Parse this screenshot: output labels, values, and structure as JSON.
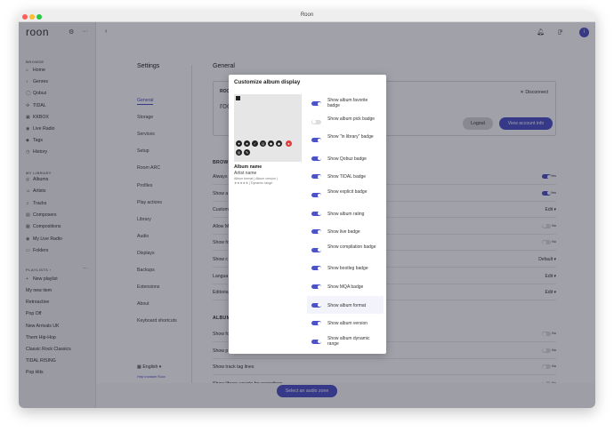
{
  "window": {
    "title": "Roon"
  },
  "sidebar": {
    "logo": "roon",
    "browse_header": "BROWSE",
    "browse": [
      {
        "icon": "home-icon",
        "glyph": "⌂",
        "label": "Home"
      },
      {
        "icon": "genres-icon",
        "glyph": "♪",
        "label": "Genres"
      },
      {
        "icon": "qobuz-icon",
        "glyph": "◯",
        "label": "Qobuz"
      },
      {
        "icon": "tidal-icon",
        "glyph": "✣",
        "label": "TIDAL"
      },
      {
        "icon": "kkbox-icon",
        "glyph": "▣",
        "label": "KKBOX"
      },
      {
        "icon": "radio-icon",
        "glyph": "◉",
        "label": "Live Radio"
      },
      {
        "icon": "tag-icon",
        "glyph": "◆",
        "label": "Tags"
      },
      {
        "icon": "history-icon",
        "glyph": "◷",
        "label": "History"
      }
    ],
    "library_header": "MY LIBRARY",
    "library": [
      {
        "icon": "albums-icon",
        "glyph": "◎",
        "label": "Albums"
      },
      {
        "icon": "artists-icon",
        "glyph": "☺",
        "label": "Artists"
      },
      {
        "icon": "tracks-icon",
        "glyph": "♫",
        "label": "Tracks"
      },
      {
        "icon": "composers-icon",
        "glyph": "▤",
        "label": "Composers"
      },
      {
        "icon": "compositions-icon",
        "glyph": "▦",
        "label": "Compositions"
      },
      {
        "icon": "radio-icon",
        "glyph": "◉",
        "label": "My Live Radio"
      },
      {
        "icon": "folder-icon",
        "glyph": "▭",
        "label": "Folders"
      }
    ],
    "playlists_header": "PLAYLISTS ›",
    "playlists_more": "···",
    "new_playlist": "New playlist",
    "playlists": [
      "My new item",
      "Retroactive",
      "Pop Off",
      "New Arrivals UK",
      "Them Hip-Hop",
      "Classic Rock Classics",
      "TIDAL RISING",
      "Pop Hits"
    ]
  },
  "settings_nav": {
    "title": "Settings",
    "items": [
      "General",
      "Storage",
      "Services",
      "Setup",
      "Room ARC",
      "Profiles",
      "Play actions",
      "Library",
      "Audio",
      "Displays",
      "Backups",
      "Extensions",
      "About",
      "Keyboard shortcuts"
    ],
    "active": "General",
    "language": "English",
    "help_link": "Help translate Roon"
  },
  "content": {
    "title": "General",
    "account_label": "ROON",
    "account_logo": "roon",
    "disconnect": "✕ Disconnect",
    "logout": "Logout",
    "view_account": "View account info",
    "browse_section": "BROWSE",
    "rows": [
      {
        "label": "Always",
        "value": "Yes",
        "toggle": "on"
      },
      {
        "label": "Show a",
        "value": "Yes",
        "toggle": "on"
      },
      {
        "label": "Custom",
        "value": "Edit ▾",
        "toggle": ""
      },
      {
        "label": "Allow M",
        "value": "No",
        "toggle": "off"
      },
      {
        "label": "Show fo",
        "value": "No",
        "toggle": "off"
      },
      {
        "label": "Show c",
        "value": "Default ▾",
        "toggle": ""
      },
      {
        "label": "Langua",
        "value": "Edit ▾",
        "toggle": ""
      },
      {
        "label": "Editoria",
        "value": "Edit ▾",
        "toggle": ""
      }
    ],
    "album_section": "ALBUM",
    "rows2": [
      {
        "label": "Show fo",
        "value": "No",
        "toggle": "off"
      },
      {
        "label": "Show p",
        "value": "No",
        "toggle": "off"
      },
      {
        "label": "Show track tag lines",
        "value": "No",
        "toggle": "off"
      },
      {
        "label": "Show library counts for recordings",
        "value": "No",
        "toggle": "off"
      }
    ]
  },
  "zone_button": "Select an audio zone",
  "modal": {
    "title": "Customize album display",
    "album_name": "Album name",
    "artist_name": "Artist name",
    "meta1": "Album format | Album version |",
    "meta2": "★★★★★ | Dynamic range",
    "options": [
      {
        "label": "Show album favorite badge",
        "on": true
      },
      {
        "label": "Show album pick badge",
        "on": false
      },
      {
        "label": "Show \"in library\" badge",
        "on": true
      },
      {
        "label": "Show Qobuz badge",
        "on": true
      },
      {
        "label": "Show TIDAL badge",
        "on": true
      },
      {
        "label": "Show explicit badge",
        "on": true
      },
      {
        "label": "Show album rating",
        "on": true
      },
      {
        "label": "Show live badge",
        "on": true
      },
      {
        "label": "Show compilation badge",
        "on": true
      },
      {
        "label": "Show bootleg badge",
        "on": true
      },
      {
        "label": "Show MQA badge",
        "on": true
      },
      {
        "label": "Show album format",
        "on": true
      },
      {
        "label": "Show album version",
        "on": true
      },
      {
        "label": "Show album dynamic range",
        "on": true
      }
    ],
    "highlighted_index": 11
  },
  "colors": {
    "accent": "#4e52c7",
    "overlay": "rgba(20,20,40,0.40)"
  }
}
